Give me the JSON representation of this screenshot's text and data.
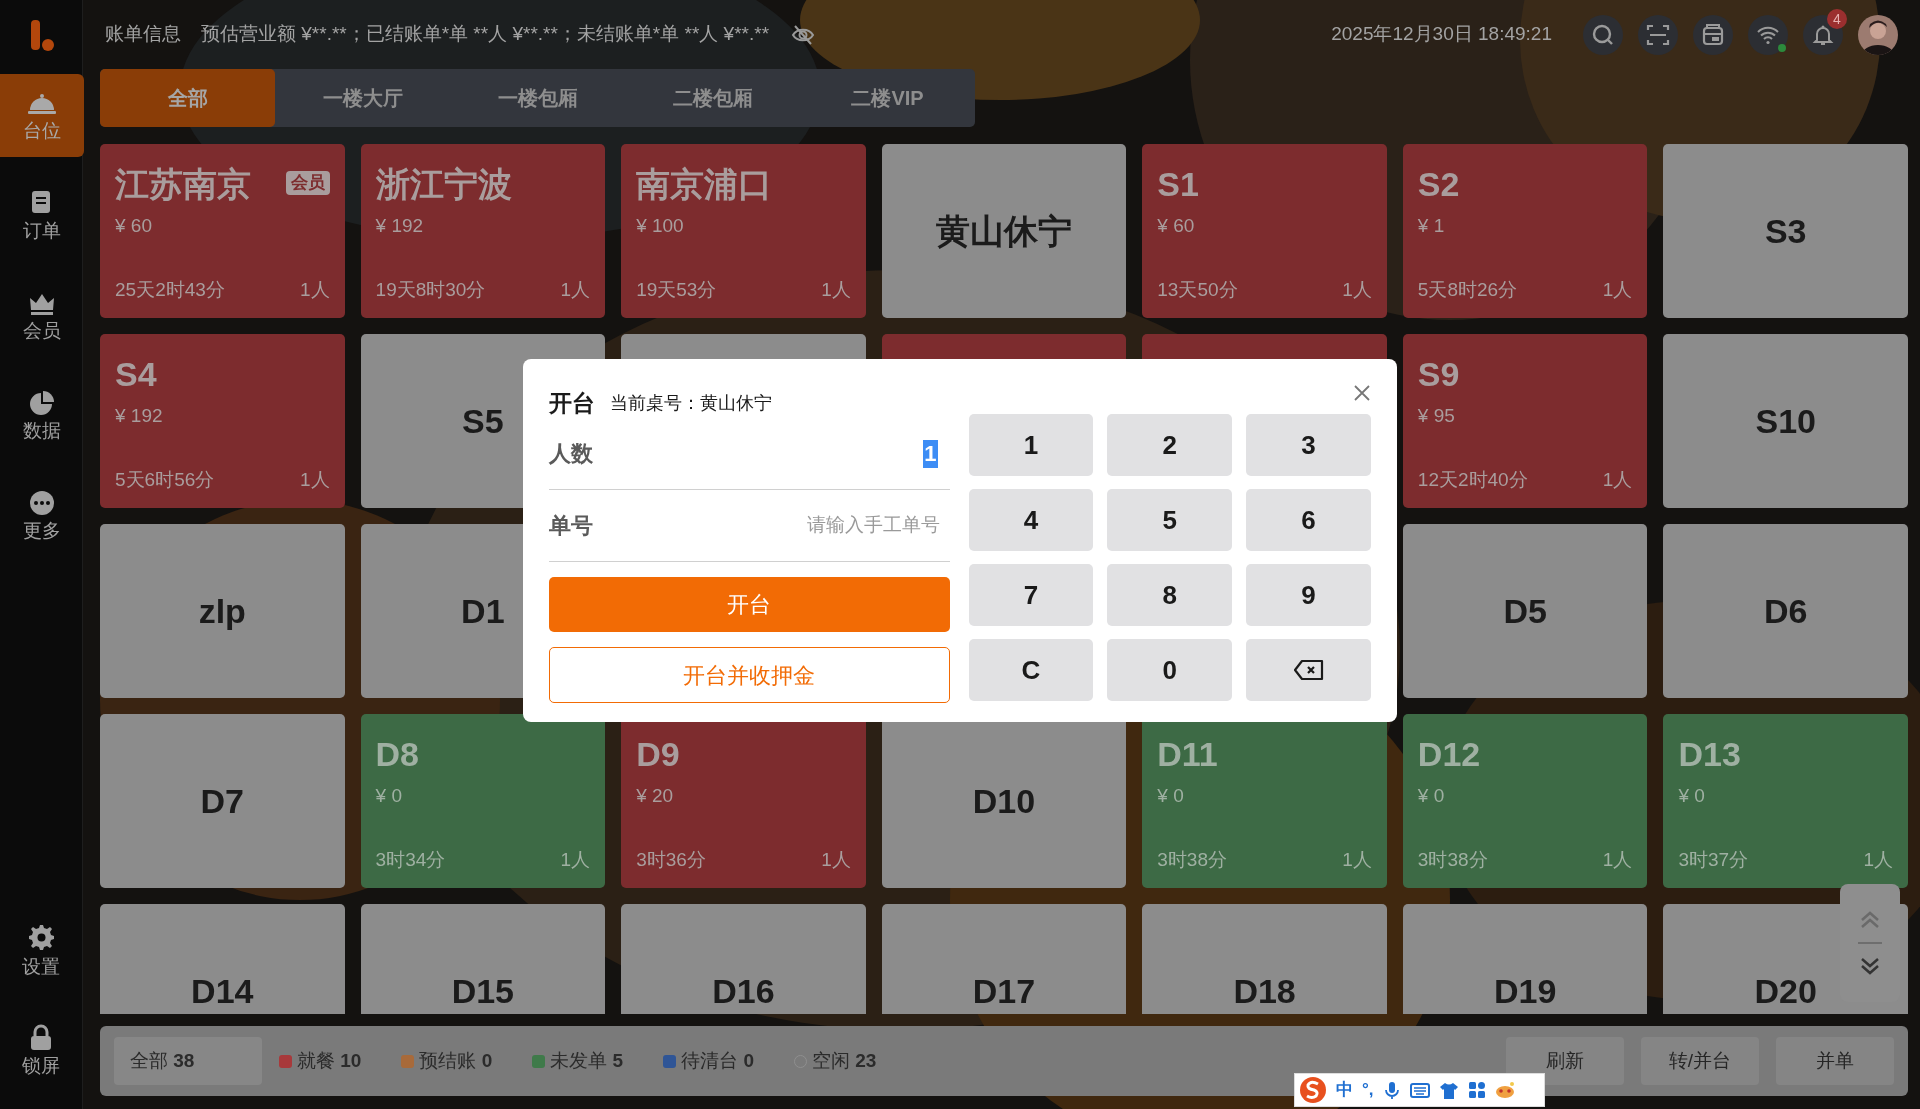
{
  "header": {
    "title": "账单信息",
    "summary": "预估营业额 ¥**.**；已结账单*单 **人 ¥**.**；未结账单*单 **人 ¥**.**",
    "datetime": "2025年12月30日 18:49:21",
    "notification_count": "4"
  },
  "sidebar": {
    "items": [
      {
        "label": "台位",
        "selected": true
      },
      {
        "label": "订单",
        "selected": false
      },
      {
        "label": "会员",
        "selected": false
      },
      {
        "label": "数据",
        "selected": false
      },
      {
        "label": "更多",
        "selected": false
      }
    ],
    "bottom_items": [
      {
        "label": "设置"
      },
      {
        "label": "锁屏"
      }
    ]
  },
  "tabs": [
    {
      "label": "全部",
      "selected": true
    },
    {
      "label": "一楼大厅",
      "selected": false
    },
    {
      "label": "一楼包厢",
      "selected": false
    },
    {
      "label": "二楼包厢",
      "selected": false
    },
    {
      "label": "二楼VIP",
      "selected": false
    }
  ],
  "tables": [
    {
      "name": "江苏南京",
      "kind": "dining",
      "badge": "会员",
      "amount": "¥ 60",
      "duration": "25天2时43分",
      "guests": "1人"
    },
    {
      "name": "浙江宁波",
      "kind": "dining",
      "amount": "¥ 192",
      "duration": "19天8时30分",
      "guests": "1人"
    },
    {
      "name": "南京浦口",
      "kind": "dining",
      "amount": "¥ 100",
      "duration": "19天53分",
      "guests": "1人"
    },
    {
      "name": "黄山休宁",
      "kind": "idle"
    },
    {
      "name": "S1",
      "kind": "dining",
      "amount": "¥ 60",
      "duration": "13天50分",
      "guests": "1人"
    },
    {
      "name": "S2",
      "kind": "dining",
      "amount": "¥ 1",
      "duration": "5天8时26分",
      "guests": "1人"
    },
    {
      "name": "S3",
      "kind": "idle"
    },
    {
      "name": "S4",
      "kind": "dining",
      "amount": "¥ 192",
      "duration": "5天6时56分",
      "guests": "1人"
    },
    {
      "name": "S5",
      "kind": "idle"
    },
    {
      "kind": "idle"
    },
    {
      "kind": "dining"
    },
    {
      "kind": "dining"
    },
    {
      "name": "S9",
      "kind": "dining",
      "amount": "¥ 95",
      "duration": "12天2时40分",
      "guests": "1人"
    },
    {
      "name": "S10",
      "kind": "idle"
    },
    {
      "name": "zlp",
      "kind": "idle"
    },
    {
      "name": "D1",
      "kind": "idle"
    },
    {
      "kind": "covered"
    },
    {
      "kind": "covered"
    },
    {
      "kind": "covered"
    },
    {
      "name": "D5",
      "kind": "idle"
    },
    {
      "name": "D6",
      "kind": "idle"
    },
    {
      "name": "D7",
      "kind": "idle"
    },
    {
      "name": "D8",
      "kind": "unsent",
      "amount": "¥ 0",
      "duration": "3时34分",
      "guests": "1人"
    },
    {
      "name": "D9",
      "kind": "dining",
      "amount": "¥ 20",
      "duration": "3时36分",
      "guests": "1人"
    },
    {
      "name": "D10",
      "kind": "idle"
    },
    {
      "name": "D11",
      "kind": "unsent",
      "amount": "¥ 0",
      "duration": "3时38分",
      "guests": "1人"
    },
    {
      "name": "D12",
      "kind": "unsent",
      "amount": "¥ 0",
      "duration": "3时38分",
      "guests": "1人"
    },
    {
      "name": "D13",
      "kind": "unsent",
      "amount": "¥ 0",
      "duration": "3时37分",
      "guests": "1人"
    },
    {
      "name": "D14",
      "kind": "idle"
    },
    {
      "name": "D15",
      "kind": "idle"
    },
    {
      "name": "D16",
      "kind": "idle"
    },
    {
      "name": "D17",
      "kind": "idle"
    },
    {
      "name": "D18",
      "kind": "idle"
    },
    {
      "name": "D19",
      "kind": "idle"
    },
    {
      "name": "D20",
      "kind": "idle"
    }
  ],
  "legend": [
    {
      "kind": "total",
      "label": "全部",
      "count": "38"
    },
    {
      "kind": "dot",
      "label": "就餐",
      "count": "10",
      "color": "#a8393b"
    },
    {
      "kind": "dot",
      "label": "预结账",
      "count": "0",
      "color": "#a86a3a"
    },
    {
      "kind": "dot",
      "label": "未发单",
      "count": "5",
      "color": "#3f7a4a"
    },
    {
      "kind": "dot",
      "label": "待清台",
      "count": "0",
      "color": "#2f5596"
    },
    {
      "kind": "hollow",
      "label": "空闲",
      "count": "23"
    }
  ],
  "actions": [
    "刷新",
    "转/并台",
    "并单"
  ],
  "modal": {
    "title": "开台",
    "subtitle": "当前桌号：黄山休宁",
    "fields": [
      {
        "label": "人数",
        "value": "1",
        "value_selected": true
      },
      {
        "label": "单号",
        "placeholder": "请输入手工单号"
      }
    ],
    "primary_button": "开台",
    "secondary_button": "开台并收押金",
    "keys": [
      {
        "kind": "digit",
        "label": "1"
      },
      {
        "kind": "digit",
        "label": "2"
      },
      {
        "kind": "digit",
        "label": "3"
      },
      {
        "kind": "digit",
        "label": "4"
      },
      {
        "kind": "digit",
        "label": "5"
      },
      {
        "kind": "digit",
        "label": "6"
      },
      {
        "kind": "digit",
        "label": "7"
      },
      {
        "kind": "digit",
        "label": "8"
      },
      {
        "kind": "digit",
        "label": "9"
      },
      {
        "kind": "digit",
        "label": "C"
      },
      {
        "kind": "digit",
        "label": "0"
      },
      {
        "kind": "backspace"
      }
    ]
  },
  "ime_toolbar": {
    "items": [
      "中",
      "°,"
    ]
  }
}
